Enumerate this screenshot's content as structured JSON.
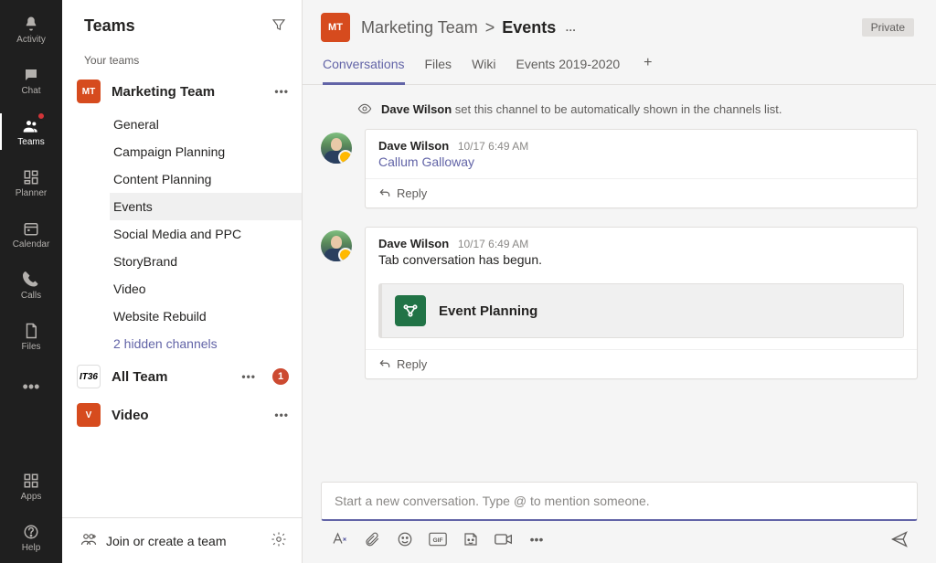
{
  "colors": {
    "brand_orange": "#d74c1f",
    "accent": "#6264a7",
    "green": "#217346"
  },
  "rail": [
    {
      "id": "activity",
      "label": "Activity",
      "icon": "bell"
    },
    {
      "id": "chat",
      "label": "Chat",
      "icon": "chat"
    },
    {
      "id": "teams",
      "label": "Teams",
      "icon": "people",
      "selected": true,
      "notification": true
    },
    {
      "id": "planner",
      "label": "Planner",
      "icon": "planner"
    },
    {
      "id": "calendar",
      "label": "Calendar",
      "icon": "calendar"
    },
    {
      "id": "calls",
      "label": "Calls",
      "icon": "phone"
    },
    {
      "id": "files",
      "label": "Files",
      "icon": "file"
    },
    {
      "id": "more",
      "label": "",
      "icon": "ellipsis"
    }
  ],
  "rail_bottom": [
    {
      "id": "apps",
      "label": "Apps",
      "icon": "apps"
    },
    {
      "id": "help",
      "label": "Help",
      "icon": "help"
    }
  ],
  "sidebar": {
    "title": "Teams",
    "your_teams_label": "Your teams",
    "teams": [
      {
        "name": "Marketing Team",
        "logo_text": "MT",
        "logo_color": "#d64b1e",
        "channels": [
          {
            "name": "General"
          },
          {
            "name": "Campaign Planning"
          },
          {
            "name": "Content Planning"
          },
          {
            "name": "Events",
            "selected": true
          },
          {
            "name": "Social Media and PPC"
          },
          {
            "name": "StoryBrand"
          },
          {
            "name": "Video"
          },
          {
            "name": "Website Rebuild"
          },
          {
            "name": "2 hidden channels",
            "link": true
          }
        ]
      },
      {
        "name": "All Team",
        "logo_text": "IT36",
        "logo_color": "#ffffff",
        "logo_fg": "#000000",
        "notifications": 1
      },
      {
        "name": "Video",
        "logo_text": "V",
        "logo_color": "#d64b1e"
      }
    ],
    "footer": {
      "label": "Join or create a team"
    }
  },
  "header": {
    "logo_text": "MT",
    "logo_color": "#d64b1e",
    "team": "Marketing Team",
    "sep": ">",
    "channel": "Events",
    "more": "…",
    "private_label": "Private"
  },
  "tabs": [
    {
      "label": "Conversations",
      "selected": true
    },
    {
      "label": "Files"
    },
    {
      "label": "Wiki"
    },
    {
      "label": "Events 2019-2020"
    }
  ],
  "system_message": {
    "author": "Dave Wilson",
    "rest": " set this channel to be automatically shown in the channels list."
  },
  "messages": [
    {
      "author": "Dave Wilson",
      "timestamp": "10/17 6:49 AM",
      "body_mention": "Callum Galloway",
      "reply_label": "Reply"
    },
    {
      "author": "Dave Wilson",
      "timestamp": "10/17 6:49 AM",
      "body_text": "Tab conversation has begun.",
      "attachment": {
        "title": "Event Planning",
        "icon": "planner"
      },
      "reply_label": "Reply"
    }
  ],
  "compose": {
    "placeholder": "Start a new conversation. Type @ to mention someone."
  }
}
